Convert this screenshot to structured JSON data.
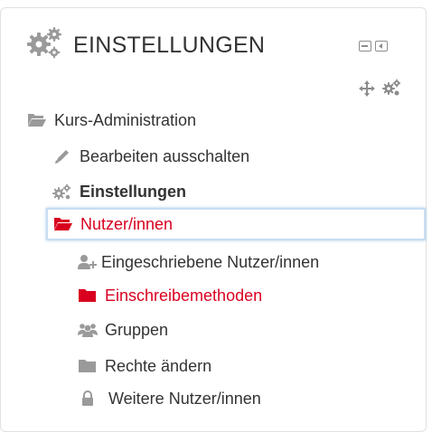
{
  "block": {
    "title": "EINSTELLUNGEN",
    "controls": {
      "hide_icon": "minus-square-icon",
      "dock_icon": "dock-left-icon",
      "move_icon": "move-icon",
      "config_icon": "gear-icon"
    }
  },
  "tree": {
    "root": {
      "label": "Kurs-Administration",
      "icon": "folder-open-icon"
    },
    "items": [
      {
        "label": "Bearbeiten ausschalten",
        "icon": "pencil-icon"
      },
      {
        "label": "Einstellungen",
        "icon": "gear-icon"
      },
      {
        "label": "Nutzer/innen",
        "icon": "folder-open-icon"
      },
      {
        "label": "Eingeschriebene Nutzer/innen",
        "icon": "user-plus-icon"
      },
      {
        "label": "Einschreibemethoden",
        "icon": "folder-icon"
      },
      {
        "label": "Gruppen",
        "icon": "users-icon"
      },
      {
        "label": "Rechte ändern",
        "icon": "folder-icon"
      },
      {
        "label": "Weitere Nutzer/innen",
        "icon": "lock-icon"
      }
    ]
  },
  "colors": {
    "accent_red": "#d9001f",
    "text": "#333333",
    "icon_gray": "#8c8c8c",
    "focus_border": "#c8def2"
  }
}
